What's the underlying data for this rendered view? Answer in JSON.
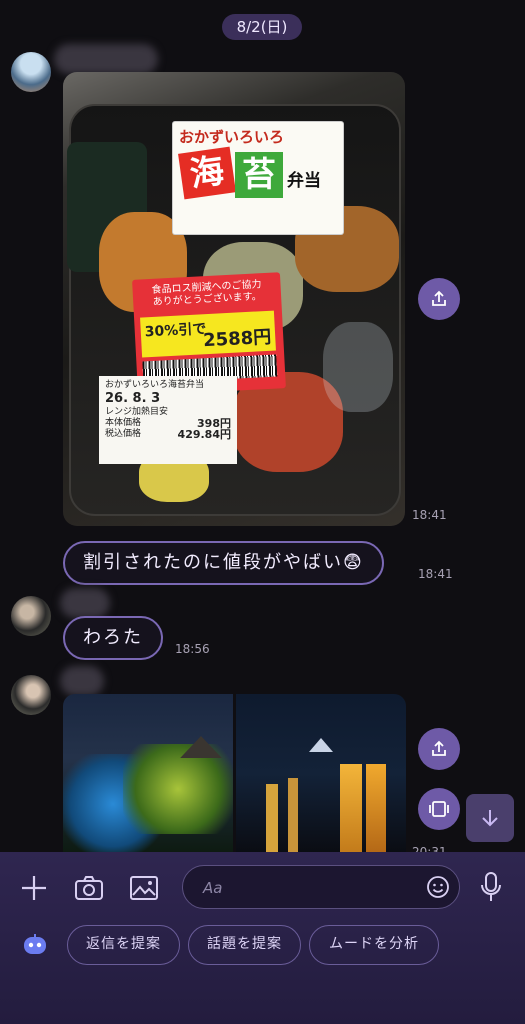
{
  "date_label": "8/2(日)",
  "messages": {
    "photo_bento": {
      "label_top": {
        "title_a": "おかず",
        "title_b": "いろいろ",
        "char_sea": "海",
        "char_nori": "苔",
        "bento": "弁当"
      },
      "price_sticker": {
        "line1": "食品ロス削減へのご協力",
        "line2": "ありがとうございます。",
        "discount": "30%引で",
        "price": "2588円"
      },
      "info_label": {
        "title": "おかずいろいろ海苔弁当",
        "expiry": "26. 8. 3",
        "body_price_label": "本体価格",
        "body_price": "398円",
        "tax_price_label": "税込価格",
        "tax_price": "429.84円",
        "note": "レンジ加熱目安"
      },
      "time": "18:41"
    },
    "text1": {
      "text": "割引されたのに値段がやばい😨",
      "time": "18:41"
    },
    "text2": {
      "text": "わろた",
      "time": "18:56"
    },
    "photo_pair": {
      "time": "20:31"
    }
  },
  "input": {
    "placeholder": "Aa"
  },
  "chips": {
    "reply": "返信を提案",
    "topic": "話題を提案",
    "mood": "ムードを分析"
  },
  "icons": {
    "plus": "plus-icon",
    "camera": "camera-icon",
    "image": "image-icon",
    "emoji": "emoji-icon",
    "mic": "mic-icon",
    "share": "share-icon",
    "gallery": "gallery-icon",
    "arrow_down": "arrow-down-icon",
    "bot": "bot-icon"
  },
  "colors": {
    "accent": "#6e5aa7",
    "bubble_border": "#7a68b4",
    "bottom_bar": "#2f2650"
  }
}
